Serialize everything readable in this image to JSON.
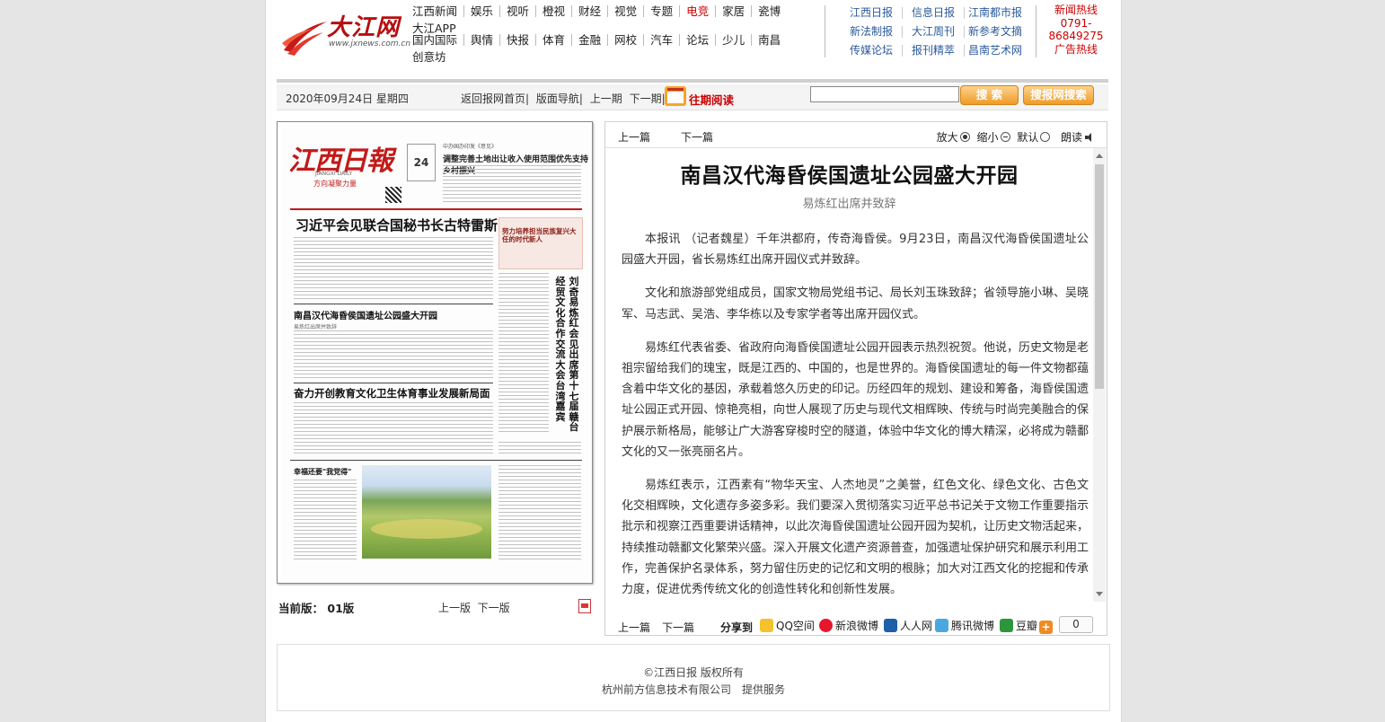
{
  "header": {
    "logo_text": "大江网",
    "logo_url": "www.jxnews.com.cn",
    "nav_row1": [
      "江西新闻",
      "娱乐",
      "视听",
      "橙视",
      "财经",
      "视觉",
      "专题",
      "电竞",
      "家居",
      "瓷博"
    ],
    "nav_row1_extra": "大江APP",
    "nav_row2": [
      "国内国际",
      "舆情",
      "快报",
      "体育",
      "金融",
      "网校",
      "汽车",
      "论坛",
      "少儿",
      "南昌"
    ],
    "nav_row2_extra": "创意坊",
    "highlight_item": "电竞",
    "papers_row1": [
      "江西日报",
      "信息日报",
      "江南都市报"
    ],
    "papers_row2": [
      "新法制报",
      "大江周刊",
      "新参考文摘"
    ],
    "papers_row3": [
      "传媒论坛",
      "报刊精萃",
      "昌南艺术网"
    ],
    "hotline_label": "新闻热线",
    "hotline_number_1": "0791-",
    "hotline_number_2": "86849275",
    "ad_hotline_label": "广告热线"
  },
  "toolbar": {
    "date": "2020年09月24日 星期四",
    "links": [
      "返回报网首页|",
      "版面导航|",
      "上一期",
      "下一期|"
    ],
    "past_issues": "往期阅读",
    "search_value": "",
    "search_button": "搜 索",
    "paper_search_button": "搜报网搜索"
  },
  "newspaper": {
    "masthead": "江西日報",
    "daily_en": "JIANGXI DAILY",
    "slogan": "方向凝聚力量",
    "date_day": "24",
    "top_kicker": "中办国办印发《意见》",
    "top_headline": "调整完善土地出让收入使用范围优先支持乡村振兴",
    "headline_main": "习近平会见联合国秘书长古特雷斯",
    "side_box": "努力培养担当民族复兴大任的时代新人",
    "headline_haihun": "南昌汉代海昏侯国遗址公园盛大开园",
    "headline_haihun_sub": "易炼红出席并致辞",
    "headline_education": "奋力开创教育文化卫生体育事业发展新局面",
    "headline_happiness": "幸福还要\"我党得\"",
    "vertical_headline_1": "刘奇易炼红会见出席第十七届赣台",
    "vertical_headline_2": "经贸文化合作交流大会台湾嘉宾"
  },
  "edition": {
    "current_label": "当前版：",
    "current_value": "01版",
    "prev": "上一版",
    "next": "下一版"
  },
  "article": {
    "prev": "上一篇",
    "next": "下一篇",
    "zoom_in": "放大",
    "zoom_out": "缩小",
    "default": "默认",
    "read_aloud": "朗读",
    "title": "南昌汉代海昏侯国遗址公园盛大开园",
    "subtitle": "易炼红出席并致辞",
    "paragraphs": [
      "本报讯 （记者魏星）千年洪都府，传奇海昏侯。9月23日，南昌汉代海昏侯国遗址公园盛大开园，省长易炼红出席开园仪式并致辞。",
      "文化和旅游部党组成员，国家文物局党组书记、局长刘玉珠致辞；省领导施小琳、吴晓军、马志武、吴浩、李华栋以及专家学者等出席开园仪式。",
      "易炼红代表省委、省政府向海昏侯国遗址公园开园表示热烈祝贺。他说，历史文物是老祖宗留给我们的瑰宝，既是江西的、中国的，也是世界的。海昏侯国遗址的每一件文物都蕴含着中华文化的基因，承载着悠久历史的印记。历经四年的规划、建设和筹备，海昏侯国遗址公园正式开园、惊艳亮相，向世人展现了历史与现代文相辉映、传统与时尚完美融合的保护展示新格局，能够让广大游客穿梭时空的隧道，体验中华文化的博大精深，必将成为赣鄱文化的又一张亮丽名片。",
      "易炼红表示，江西素有“物华天宝、人杰地灵”之美誉，红色文化、绿色文化、古色文化交相辉映，文化遗存多姿多彩。我们要深入贯彻落实习近平总书记关于文物工作重要指示批示和视察江西重要讲话精神，以此次海昏侯国遗址公园开园为契机，让历史文物活起来，持续推动赣鄱文化繁荣兴盛。深入开展文化遗产资源普查，加强遗址保护研究和展示利用工作，完善保护名录体系，努力留住历史的记忆和文明的根脉；加大对江西文化的挖掘和传承力度，促进优秀传统文化的创造性转化和创新性发展。"
    ],
    "bottom_prev": "上一篇",
    "bottom_next": "下一篇",
    "share_label": "分享到",
    "share": {
      "qzone": "QQ空间",
      "weibo": "新浪微博",
      "renren": "人人网",
      "tencent": "腾讯微博",
      "douban": "豆瓣"
    },
    "share_count": "0"
  },
  "footer": {
    "copyright": "©江西日报 版权所有",
    "provider": "杭州前方信息技术有限公司　提供服务"
  },
  "colors": {
    "brand_red": "#c00000",
    "paper_link_blue": "#2a5a9c",
    "button_orange": "#ef9b27"
  }
}
